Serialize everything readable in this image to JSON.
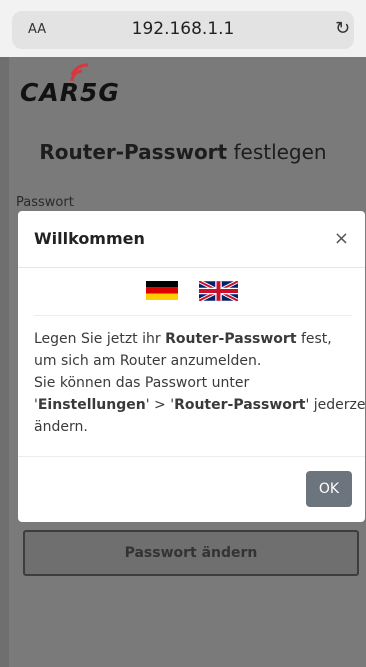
{
  "browser": {
    "text_size_label": "AA",
    "url": "192.168.1.1",
    "reload_icon": "reload-icon"
  },
  "logo": {
    "text_left": "CAR",
    "text_right": "5G"
  },
  "page": {
    "title_bold": "Router-Passwort",
    "title_rest": " festlegen",
    "password_label": "Passwort",
    "change_button": "Passwort ändern"
  },
  "modal": {
    "title": "Willkommen",
    "close": "×",
    "body": {
      "l1_pre": "Legen Sie jetzt ihr ",
      "l1_bold": "Router-Passwort",
      "l1_post": " fest,",
      "l2": "um sich am Router anzumelden.",
      "l3": "Sie können das Passwort unter",
      "l4_a": "'",
      "l4_b": "Einstellungen",
      "l4_c": "' > '",
      "l4_d": "Router-Passwort",
      "l4_e": "' jederzeit",
      "l5": "ändern."
    },
    "ok": "OK"
  },
  "colors": {
    "accent_red": "#d9373b",
    "ok_button": "#6c757d"
  }
}
